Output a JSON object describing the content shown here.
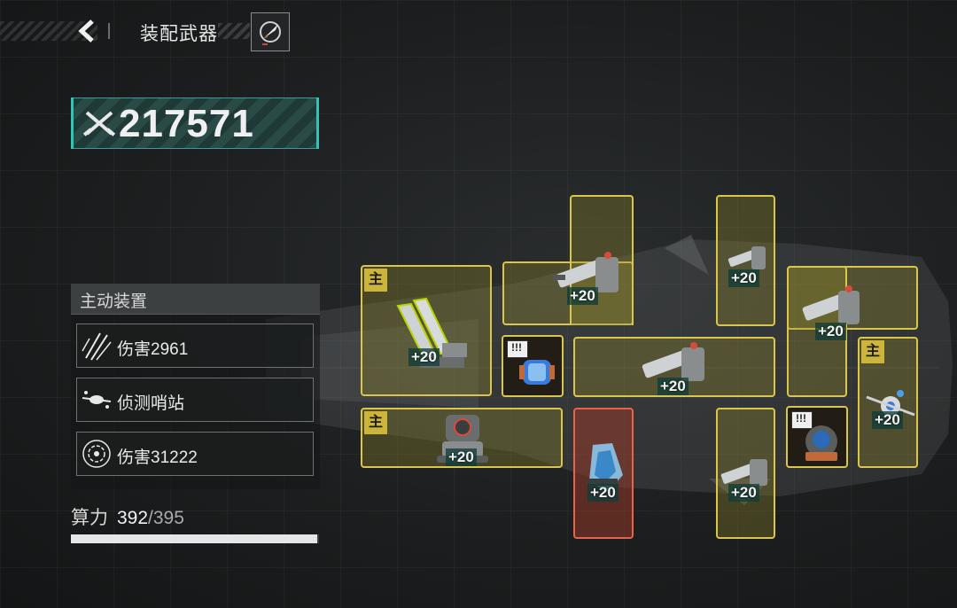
{
  "header": {
    "title": "装配武器"
  },
  "combat_power": {
    "value": "217571"
  },
  "active_equipment": {
    "title": "主动装置",
    "slots": [
      {
        "icon": "claw-slash-icon",
        "label": "伤害2961"
      },
      {
        "icon": "drone-scout-icon",
        "label": "侦测哨站"
      },
      {
        "icon": "target-ring-icon",
        "label": "伤害31222"
      }
    ]
  },
  "compute": {
    "label": "算力",
    "current": "392",
    "max": "/395",
    "fraction": 0.992
  },
  "modules": {
    "main_tag": "主",
    "level": "+20",
    "chip_label": "!!!",
    "items": [
      {
        "name": "missile-launcher",
        "level": "+20",
        "main": true
      },
      {
        "name": "heavy-cannon-top",
        "level": "+20"
      },
      {
        "name": "energy-cell",
        "level": ""
      },
      {
        "name": "cannon-center",
        "level": "+20"
      },
      {
        "name": "cannon-tall",
        "level": "+20"
      },
      {
        "name": "cannon-right",
        "level": "+20"
      },
      {
        "name": "drone-satellite",
        "level": "+20",
        "main": true
      },
      {
        "name": "mech-turret",
        "level": "+20",
        "main": true
      },
      {
        "name": "plasma-pod",
        "level": "+20"
      },
      {
        "name": "cannon-lower",
        "level": "+20"
      },
      {
        "name": "reactor-core",
        "level": ""
      }
    ]
  },
  "colors": {
    "accent": "#34c4b6",
    "slot_border": "#d9c64a",
    "slot_red": "#e8634a"
  }
}
